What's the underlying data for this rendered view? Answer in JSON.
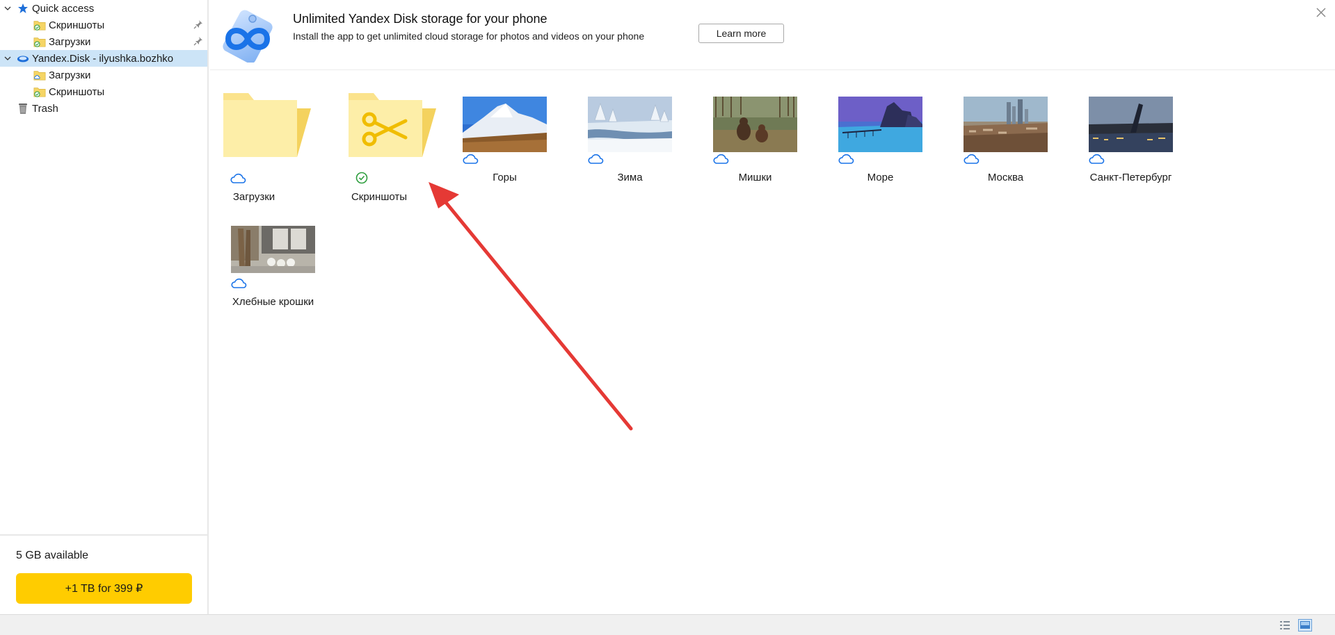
{
  "sidebar": {
    "items": [
      {
        "label": "Quick access",
        "icon": "star-icon",
        "level": 0,
        "expanded": true
      },
      {
        "label": "Скриншоты",
        "icon": "folder-synced-icon",
        "level": 1,
        "pinned": true
      },
      {
        "label": "Загрузки",
        "icon": "folder-synced-icon",
        "level": 1,
        "pinned": true
      },
      {
        "label": "Yandex.Disk - ilyushka.bozhko",
        "icon": "yandex-disk-icon",
        "level": 0,
        "expanded": true,
        "selected": true
      },
      {
        "label": "Загрузки",
        "icon": "folder-cloud-icon",
        "level": 1
      },
      {
        "label": "Скриншоты",
        "icon": "folder-synced-icon",
        "level": 1
      },
      {
        "label": "Trash",
        "icon": "trash-icon",
        "level": 0
      }
    ],
    "storage_text": "5 GB available",
    "upgrade_label": "+1 TB for 399 ₽"
  },
  "banner": {
    "title": "Unlimited Yandex Disk storage for your phone",
    "subtitle": "Install the app to get unlimited cloud storage for photos and videos on your phone",
    "learn_more_label": "Learn more",
    "close_icon": "close-icon"
  },
  "items": [
    {
      "label": "Загрузки",
      "kind": "folder",
      "status": "cloud"
    },
    {
      "label": "Скриншоты",
      "kind": "folder-scissors",
      "status": "synced"
    },
    {
      "label": "Горы",
      "kind": "photo",
      "status": "cloud"
    },
    {
      "label": "Зима",
      "kind": "photo",
      "status": "cloud"
    },
    {
      "label": "Мишки",
      "kind": "photo",
      "status": "cloud"
    },
    {
      "label": "Море",
      "kind": "photo",
      "status": "cloud"
    },
    {
      "label": "Москва",
      "kind": "photo",
      "status": "cloud"
    },
    {
      "label": "Санкт-Петербург",
      "kind": "photo",
      "status": "cloud"
    },
    {
      "label": "Хлебные крошки",
      "kind": "photo",
      "status": "cloud"
    }
  ],
  "statusbar": {
    "views": [
      "details-view-icon",
      "large-icons-view-icon"
    ],
    "active_view": "large-icons-view-icon"
  },
  "colors": {
    "accent_yellow": "#ffcc00",
    "selection": "#cce4f7",
    "cloud_blue": "#1a73e8",
    "sync_green": "#2e9e3e",
    "arrow_red": "#e53935"
  }
}
